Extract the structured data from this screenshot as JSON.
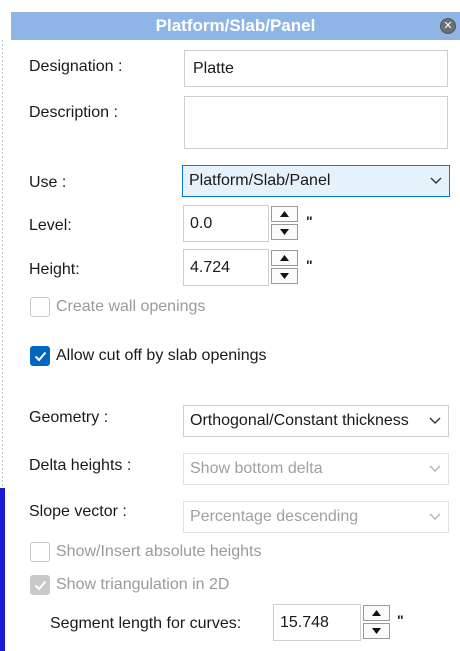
{
  "window": {
    "title": "Platform/Slab/Panel",
    "close_icon": "close-icon"
  },
  "fields": {
    "designation": {
      "label": "Designation :",
      "value": "Platte"
    },
    "description": {
      "label": "Description :",
      "value": ""
    },
    "use": {
      "label": "Use :",
      "value": "Platform/Slab/Panel"
    },
    "level": {
      "label": "Level:",
      "value": "0.0",
      "unit": "\""
    },
    "height": {
      "label": "Height:",
      "value": "4.724",
      "unit": "\""
    },
    "geometry": {
      "label": "Geometry :",
      "value": "Orthogonal/Constant thickness"
    },
    "delta_heights": {
      "label": "Delta heights :",
      "value": "Show bottom delta"
    },
    "slope_vector": {
      "label": "Slope vector :",
      "value": "Percentage descending"
    },
    "segment_length": {
      "label": "Segment length for curves:",
      "value": "15.748",
      "unit": "\""
    }
  },
  "checkboxes": {
    "create_wall_openings": {
      "label": "Create wall openings",
      "checked": false,
      "enabled": false
    },
    "allow_cut_off": {
      "label": "Allow cut off by slab openings",
      "checked": true,
      "enabled": true
    },
    "show_insert_abs": {
      "label": "Show/Insert absolute heights",
      "checked": false,
      "enabled": false
    },
    "show_triangulation": {
      "label": "Show triangulation in 2D",
      "checked": true,
      "enabled": false
    }
  },
  "colors": {
    "title_bar": "#8fb5e6",
    "accent": "#0067c0",
    "left_bar": "#1a1ad6"
  }
}
